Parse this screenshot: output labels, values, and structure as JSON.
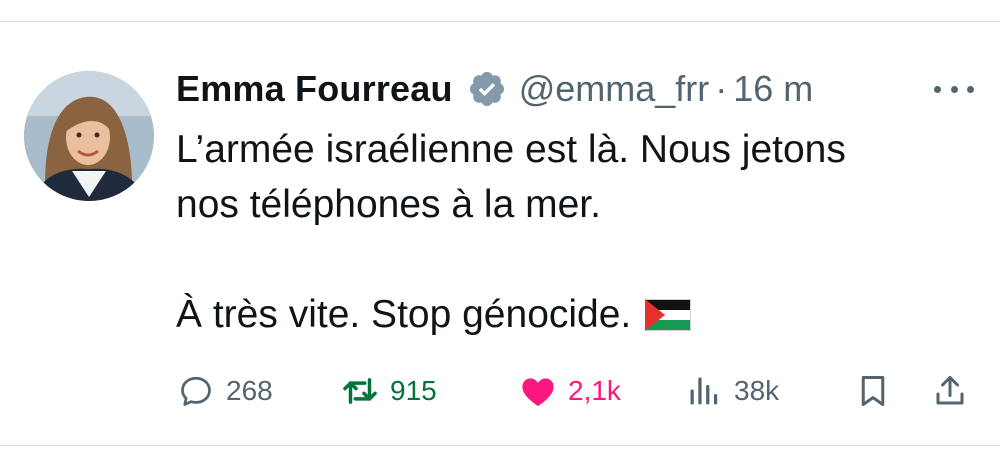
{
  "tweet": {
    "author": {
      "name": "Emma Fourreau",
      "handle": "@emma_frr",
      "verified": true,
      "avatar_icon": "profile-photo"
    },
    "separator": "·",
    "timestamp": "16 m",
    "text": "L’armée israélienne est là. Nous jetons\nnos téléphones à la mer.\n\nÀ très vite. Stop génocide.",
    "emoji": "palestine-flag",
    "stats": {
      "replies": "268",
      "retweets": "915",
      "likes": "2,1k",
      "views": "38k"
    }
  },
  "icons": {
    "more": "more-horizontal-icon",
    "reply": "reply-icon",
    "retweet": "retweet-icon",
    "like": "heart-icon",
    "views": "views-icon",
    "bookmark": "bookmark-icon",
    "share": "share-icon"
  },
  "colors": {
    "text": "#0f1419",
    "secondary": "#536471",
    "verified": "#829aab",
    "retweet_active": "#00753a",
    "like_active": "#f91880"
  }
}
